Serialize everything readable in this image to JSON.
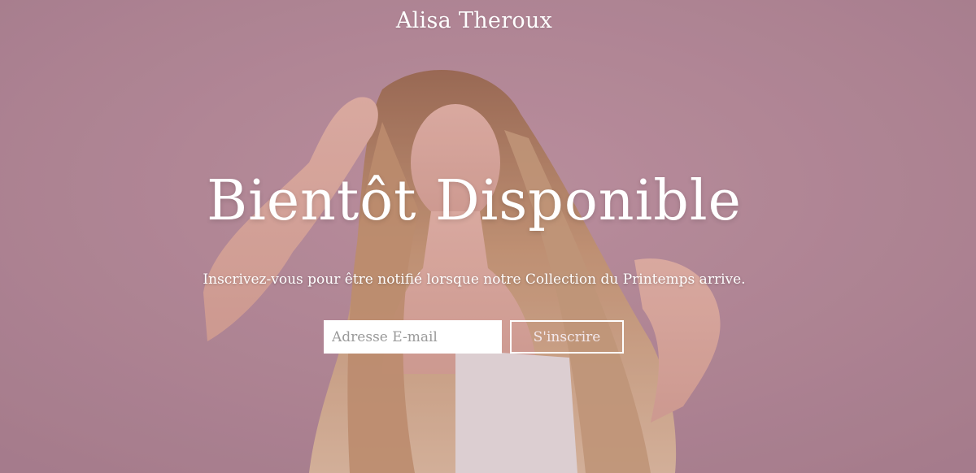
{
  "brand": {
    "name": "Alisa Theroux"
  },
  "hero": {
    "headline": "Bientôt Disponible",
    "subline": "Inscrivez-vous pour être notifié lorsque notre Collection du Printemps arrive."
  },
  "signup": {
    "email_placeholder": "Adresse E-mail",
    "email_value": "",
    "subscribe_label": "S'inscrire"
  },
  "colors": {
    "background": "#b38a97",
    "text": "#ffffff",
    "button_border": "#ffffff"
  }
}
